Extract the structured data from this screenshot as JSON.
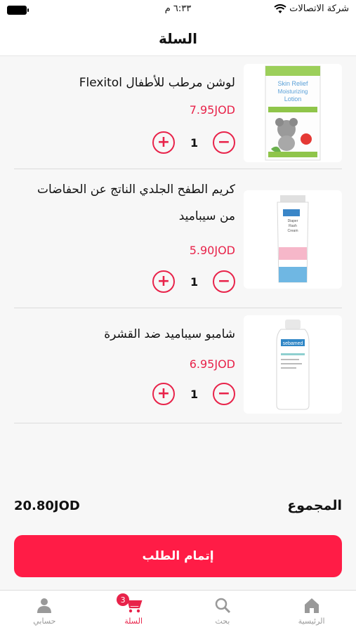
{
  "status": {
    "carrier": "شركة الاتصالات",
    "time": "٦:٣٣ م"
  },
  "header": {
    "title": "السلة"
  },
  "items": [
    {
      "name": "لوشن مرطب للأطفال Flexitol",
      "price": "7.95JOD",
      "qty": "1",
      "product_text": "Skin Relief Moisturizing Lotion"
    },
    {
      "name": "كريم الطفح الجلدي الناتج عن الحفاضات من سيباميد",
      "price": "5.90JOD",
      "qty": "1",
      "product_text": "Diaper Rash Cream"
    },
    {
      "name": "شامبو سيباميد ضد القشرة",
      "price": "6.95JOD",
      "qty": "1",
      "product_text": "sebamed"
    }
  ],
  "summary": {
    "total_label": "المجموع",
    "total_value": "20.80JOD"
  },
  "checkout": {
    "label": "إتمام الطلب"
  },
  "tabs": {
    "home": "الرئيسية",
    "search": "بحث",
    "cart": "السلة",
    "cart_count": "3",
    "account": "حسابي"
  },
  "colors": {
    "accent": "#e8234a",
    "button": "#ff1c46"
  }
}
